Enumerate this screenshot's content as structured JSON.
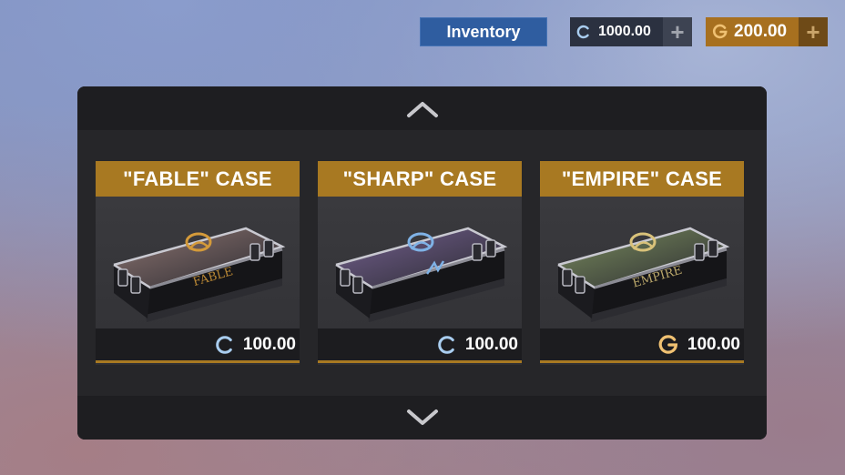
{
  "topbar": {
    "inventory_label": "Inventory",
    "credits_value": "1000.00",
    "gold_value": "200.00",
    "plus_symbol": "+"
  },
  "colors": {
    "credit_icon": "#a9cdef",
    "gold_icon": "#f0c172",
    "case_title_bg": "#a87922"
  },
  "cases": [
    {
      "title": "\"FABLE\" CASE",
      "price": "100.00",
      "currency": "credits",
      "logo_text": "FABLE",
      "emblem_color": "#d49a3a",
      "lid_tint": "#6a5a5a"
    },
    {
      "title": "\"SHARP\" CASE",
      "price": "100.00",
      "currency": "credits",
      "logo_text": "",
      "emblem_color": "#7fb2e6",
      "lid_tint": "#5a4d6e"
    },
    {
      "title": "\"EMPIRE\" CASE",
      "price": "100.00",
      "currency": "gold",
      "logo_text": "EMPIRE",
      "emblem_color": "#d9c27a",
      "lid_tint": "#5e6a4e"
    }
  ]
}
